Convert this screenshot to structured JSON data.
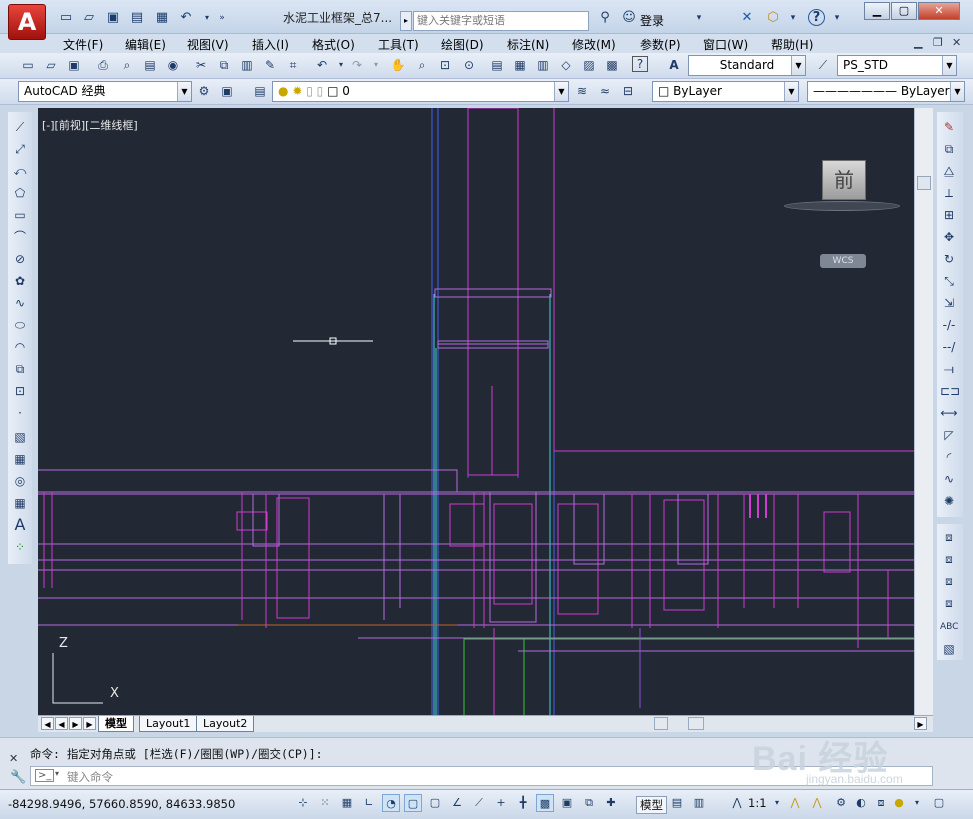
{
  "titlebar": {
    "doc_title": "水泥工业框架_总7...",
    "search_placeholder": "键入关键字或短语",
    "login": "登录",
    "app_logo": "A"
  },
  "menus": [
    "文件(F)",
    "编辑(E)",
    "视图(V)",
    "插入(I)",
    "格式(O)",
    "工具(T)",
    "绘图(D)",
    "标注(N)",
    "修改(M)",
    "参数(P)",
    "窗口(W)",
    "帮助(H)"
  ],
  "toolbar": {
    "text_style": "Standard",
    "dim_style": "PS_STD",
    "workspace": "AutoCAD 经典",
    "layer": "0",
    "color": "ByLayer",
    "linetype": "ByLayer"
  },
  "viewport": {
    "label": "[-][前视][二维线框]",
    "viewcube_face": "前",
    "wcs": "WCS",
    "ucs_z": "Z",
    "ucs_x": "X"
  },
  "tabs": {
    "model": "模型",
    "layout1": "Layout1",
    "layout2": "Layout2"
  },
  "command": {
    "history": "命令: 指定对角点或 [栏选(F)/圈围(WP)/圈交(CP)]:",
    "input_placeholder": "键入命令"
  },
  "status": {
    "coordinates": "-84298.9496, 57660.8590, 84633.9850",
    "model_label": "模型",
    "scale": "1:1"
  },
  "watermark": {
    "brand": "Bai 经验",
    "url": "jingyan.baidu.com"
  },
  "colors": {
    "drawing_bg": "#222935",
    "magenta": "#d03bd0",
    "cyan": "#3fd6d6",
    "green": "#32c832",
    "blue": "#4a5cf0",
    "violet": "#b56ce0"
  }
}
